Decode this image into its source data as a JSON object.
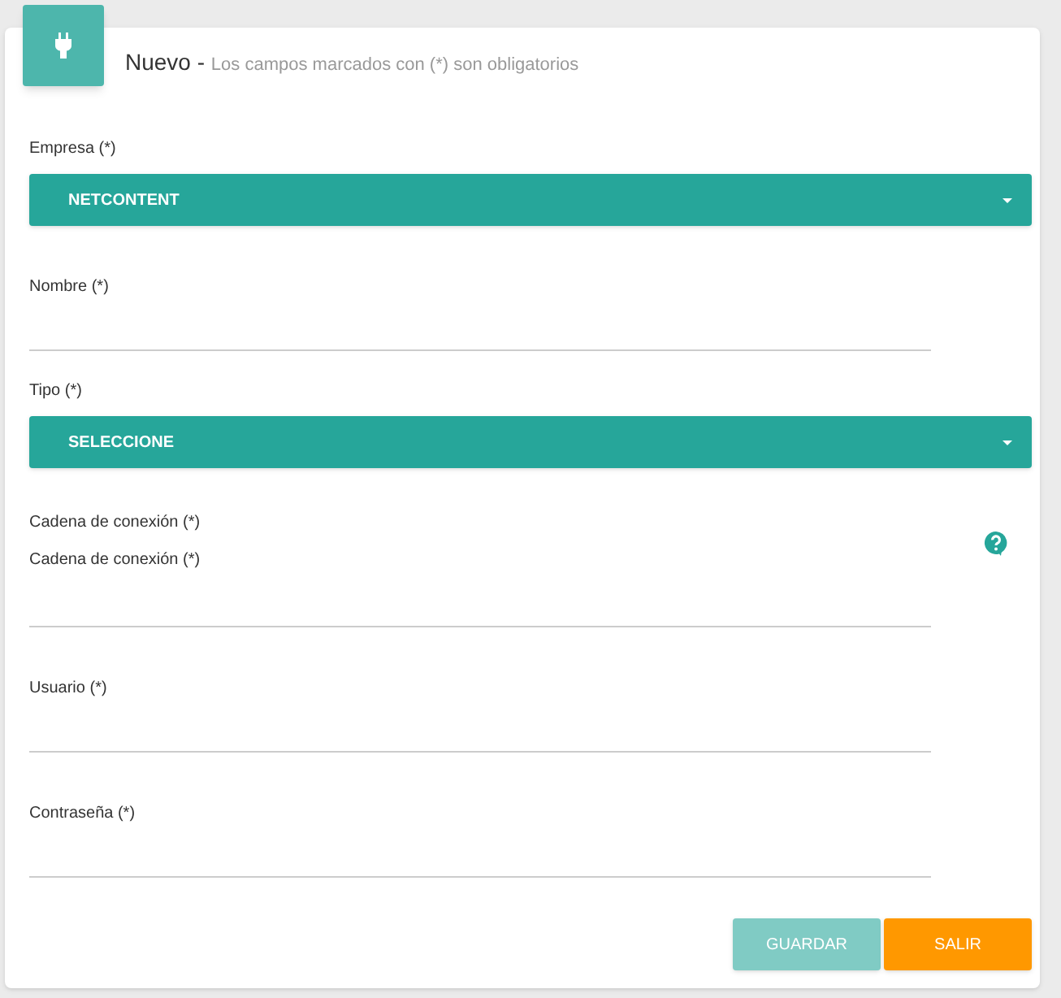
{
  "header": {
    "title": "Nuevo",
    "separator": "-",
    "subtitle": "Los campos marcados con (*) son obligatorios"
  },
  "fields": [
    {
      "kind": "select",
      "label": "Empresa (*)",
      "value": "NETCONTENT"
    },
    {
      "kind": "text",
      "label": "Nombre (*)"
    },
    {
      "kind": "select",
      "label": "Tipo (*)",
      "value": "SELECCIONE"
    },
    {
      "kind": "help",
      "label": "Cadena de conexión (*)",
      "sublabel": "Cadena de conexión (*)"
    },
    {
      "kind": "text",
      "label": "Usuario (*)"
    },
    {
      "kind": "text",
      "label": "Contraseña (*)"
    }
  ],
  "buttons": [
    {
      "label": "GUARDAR",
      "kind": "save",
      "disabled": true
    },
    {
      "label": "SALIR",
      "kind": "exit",
      "disabled": false
    }
  ]
}
